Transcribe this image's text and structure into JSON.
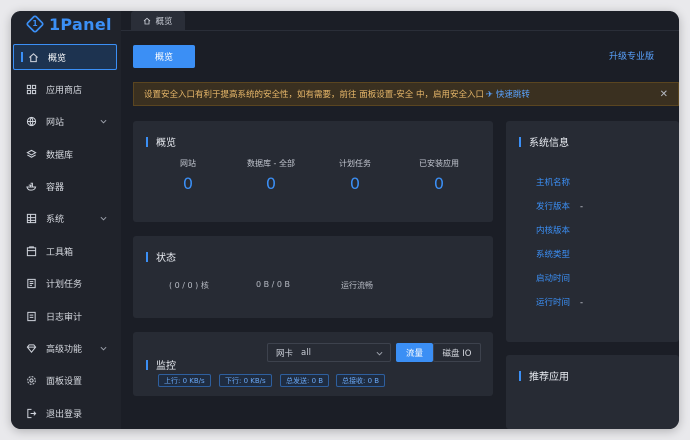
{
  "app": {
    "logo_text": "1Panel",
    "logo_letter": "1"
  },
  "sidebar": {
    "items": [
      {
        "label": "概览",
        "icon": "home-icon",
        "active": true,
        "chevron": false
      },
      {
        "label": "应用商店",
        "icon": "grid-icon",
        "active": false,
        "chevron": false
      },
      {
        "label": "网站",
        "icon": "globe-icon",
        "active": false,
        "chevron": true
      },
      {
        "label": "数据库",
        "icon": "layers-icon",
        "active": false,
        "chevron": false
      },
      {
        "label": "容器",
        "icon": "docker-icon",
        "active": false,
        "chevron": false
      },
      {
        "label": "系统",
        "icon": "server-icon",
        "active": false,
        "chevron": true
      },
      {
        "label": "工具箱",
        "icon": "toolbox-icon",
        "active": false,
        "chevron": false
      },
      {
        "label": "计划任务",
        "icon": "task-icon",
        "active": false,
        "chevron": false
      },
      {
        "label": "日志审计",
        "icon": "log-icon",
        "active": false,
        "chevron": false
      },
      {
        "label": "高级功能",
        "icon": "diamond-icon",
        "active": false,
        "chevron": true
      },
      {
        "label": "面板设置",
        "icon": "gear-icon",
        "active": false,
        "chevron": false
      },
      {
        "label": "退出登录",
        "icon": "logout-icon",
        "active": false,
        "chevron": false
      }
    ]
  },
  "tabbar": {
    "tab_label": "概览"
  },
  "header": {
    "overview_button": "概览",
    "upgrade_link": "升级专业版"
  },
  "notice": {
    "text": "设置安全入口有利于提高系统的安全性，如有需要，前往 面板设置-安全 中，启用安全入口",
    "link": "快速跳转",
    "close": "✕"
  },
  "overview": {
    "title": "概览",
    "stats": [
      {
        "label": "网站",
        "value": "0"
      },
      {
        "label": "数据库 - 全部",
        "value": "0"
      },
      {
        "label": "计划任务",
        "value": "0"
      },
      {
        "label": "已安装应用",
        "value": "0"
      }
    ]
  },
  "status": {
    "title": "状态",
    "items": [
      "( 0 / 0 ) 核",
      "0 B / 0 B",
      "运行流畅"
    ]
  },
  "monitor": {
    "title": "监控",
    "nic_label": "网卡",
    "nic_value": "all",
    "seg_traffic": "流量",
    "seg_disk": "磁盘 IO",
    "chips": [
      "上行: 0 KB/s",
      "下行: 0 KB/s",
      "总发送: 0 B",
      "总接收: 0 B"
    ]
  },
  "sysinfo": {
    "title": "系统信息",
    "rows": [
      {
        "label": "主机名称",
        "value": ""
      },
      {
        "label": "发行版本",
        "value": "-"
      },
      {
        "label": "内核版本",
        "value": ""
      },
      {
        "label": "系统类型",
        "value": ""
      },
      {
        "label": "启动时间",
        "value": ""
      },
      {
        "label": "运行时间",
        "value": "-"
      }
    ]
  },
  "recommend": {
    "title": "推荐应用"
  },
  "colors": {
    "accent": "#3b8ff5",
    "background": "#1b1e26",
    "card": "#272b34",
    "warning": "#e8b86a"
  }
}
